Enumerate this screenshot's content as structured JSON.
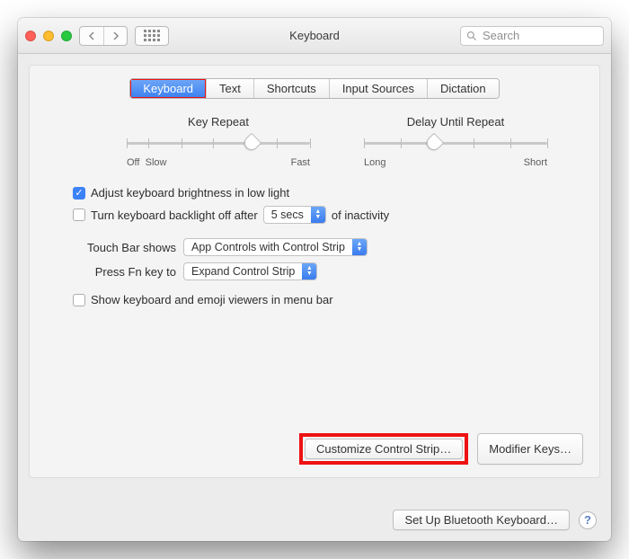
{
  "window": {
    "title": "Keyboard"
  },
  "search": {
    "placeholder": "Search"
  },
  "tabs": [
    "Keyboard",
    "Text",
    "Shortcuts",
    "Input Sources",
    "Dictation"
  ],
  "sliders": {
    "key_repeat": {
      "title": "Key Repeat",
      "left1": "Off",
      "left2": "Slow",
      "right": "Fast"
    },
    "delay": {
      "title": "Delay Until Repeat",
      "left": "Long",
      "right": "Short"
    }
  },
  "checks": {
    "brightness": "Adjust keyboard brightness in low light",
    "backlight_a": "Turn keyboard backlight off after",
    "backlight_b": "of inactivity",
    "viewers": "Show keyboard and emoji viewers in menu bar"
  },
  "selects": {
    "backlight_delay": "5 secs",
    "touchbar_shows": "App Controls with Control Strip",
    "fn_key": "Expand Control Strip"
  },
  "labels": {
    "touchbar": "Touch Bar shows",
    "fn": "Press Fn key to"
  },
  "buttons": {
    "customize": "Customize Control Strip…",
    "modifier": "Modifier Keys…",
    "bluetooth": "Set Up Bluetooth Keyboard…"
  }
}
